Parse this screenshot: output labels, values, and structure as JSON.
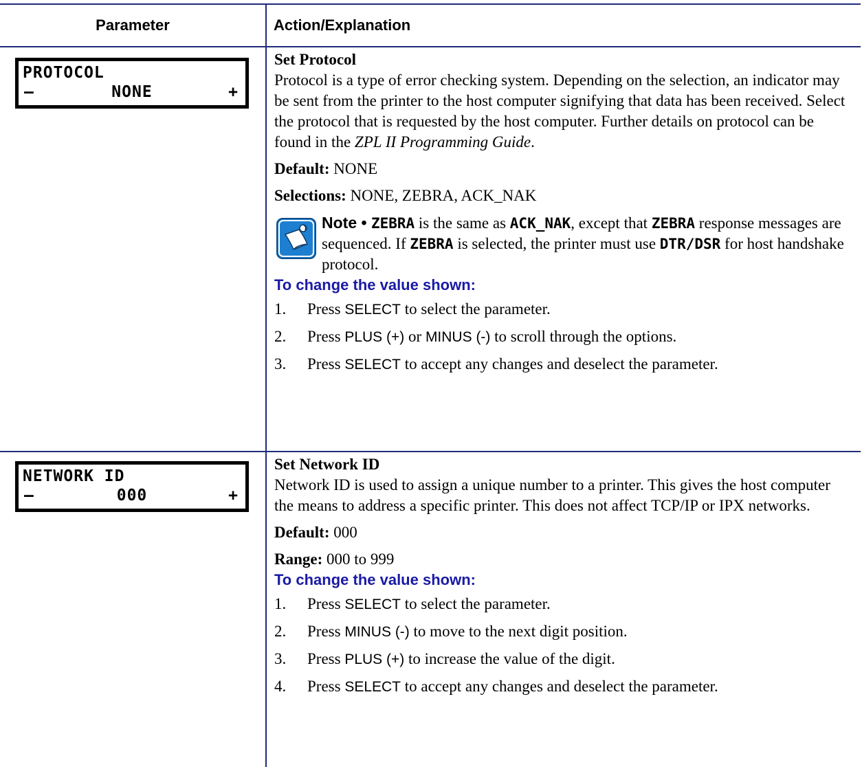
{
  "header": {
    "parameter": "Parameter",
    "action": "Action/Explanation"
  },
  "rows": [
    {
      "lcd": {
        "line1": "PROTOCOL",
        "minus": "–",
        "value": "NONE",
        "plus": "+"
      },
      "title": "Set Protocol",
      "desc_main": "Protocol is a type of error checking system. Depending on the selection, an indicator may be sent from the printer to the host computer signifying that data has been received. Select the protocol that is requested by the host computer. Further details on protocol can be found in the ",
      "desc_italic": "ZPL II Programming Guide",
      "desc_end": ".",
      "default_label": "Default:",
      "default_value": " NONE",
      "selections_label": "Selections:",
      "selections_value": " NONE, ZEBRA, ACK_NAK",
      "note": {
        "label": "Note • ",
        "kw1": "ZEBRA",
        "t1": " is the same as ",
        "kw2": "ACK_NAK",
        "t2": ", except that ",
        "kw3": "ZEBRA",
        "t3": " response messages are sequenced. If ",
        "kw4": "ZEBRA",
        "t4": " is selected, the printer must use ",
        "kw5": "DTR/DSR",
        "t5": " for host handshake protocol."
      },
      "procedure_title": "To change the value shown:",
      "steps": [
        {
          "num": "1.",
          "pre": "Press ",
          "key": "SELECT",
          "post": " to select the parameter."
        },
        {
          "num": "2.",
          "pre": "Press ",
          "key": "PLUS (+)",
          "mid": " or ",
          "key2": "MINUS (-)",
          "post": " to scroll through the options."
        },
        {
          "num": "3.",
          "pre": "Press ",
          "key": "SELECT",
          "post": " to accept any changes and deselect the parameter."
        }
      ]
    },
    {
      "lcd": {
        "line1": "NETWORK ID",
        "minus": "–",
        "value": "000",
        "plus": "+"
      },
      "title": "Set Network ID",
      "desc_main": "Network ID is used to assign a unique number to a printer. This gives the host computer the means to address a specific printer. This does not affect TCP/IP or IPX networks.",
      "default_label": "Default:",
      "default_value": " 000",
      "range_label": "Range:",
      "range_value": " 000 to 999",
      "procedure_title": "To change the value shown:",
      "steps": [
        {
          "num": "1.",
          "pre": "Press ",
          "key": "SELECT",
          "post": " to select the parameter."
        },
        {
          "num": "2.",
          "pre": "Press ",
          "key": "MINUS (-)",
          "post": " to move to the next digit position."
        },
        {
          "num": "3.",
          "pre": "Press ",
          "key": "PLUS (+)",
          "post": " to increase the value of the digit."
        },
        {
          "num": "4.",
          "pre": "Press ",
          "key": "SELECT",
          "post": " to accept any changes and deselect the parameter."
        }
      ]
    }
  ],
  "colors": {
    "rule": "#1f2a7a",
    "procedure_title": "#1a1aa6",
    "note_icon": "#1e7fd0"
  },
  "icons": {
    "note": "note-pencil-icon"
  }
}
